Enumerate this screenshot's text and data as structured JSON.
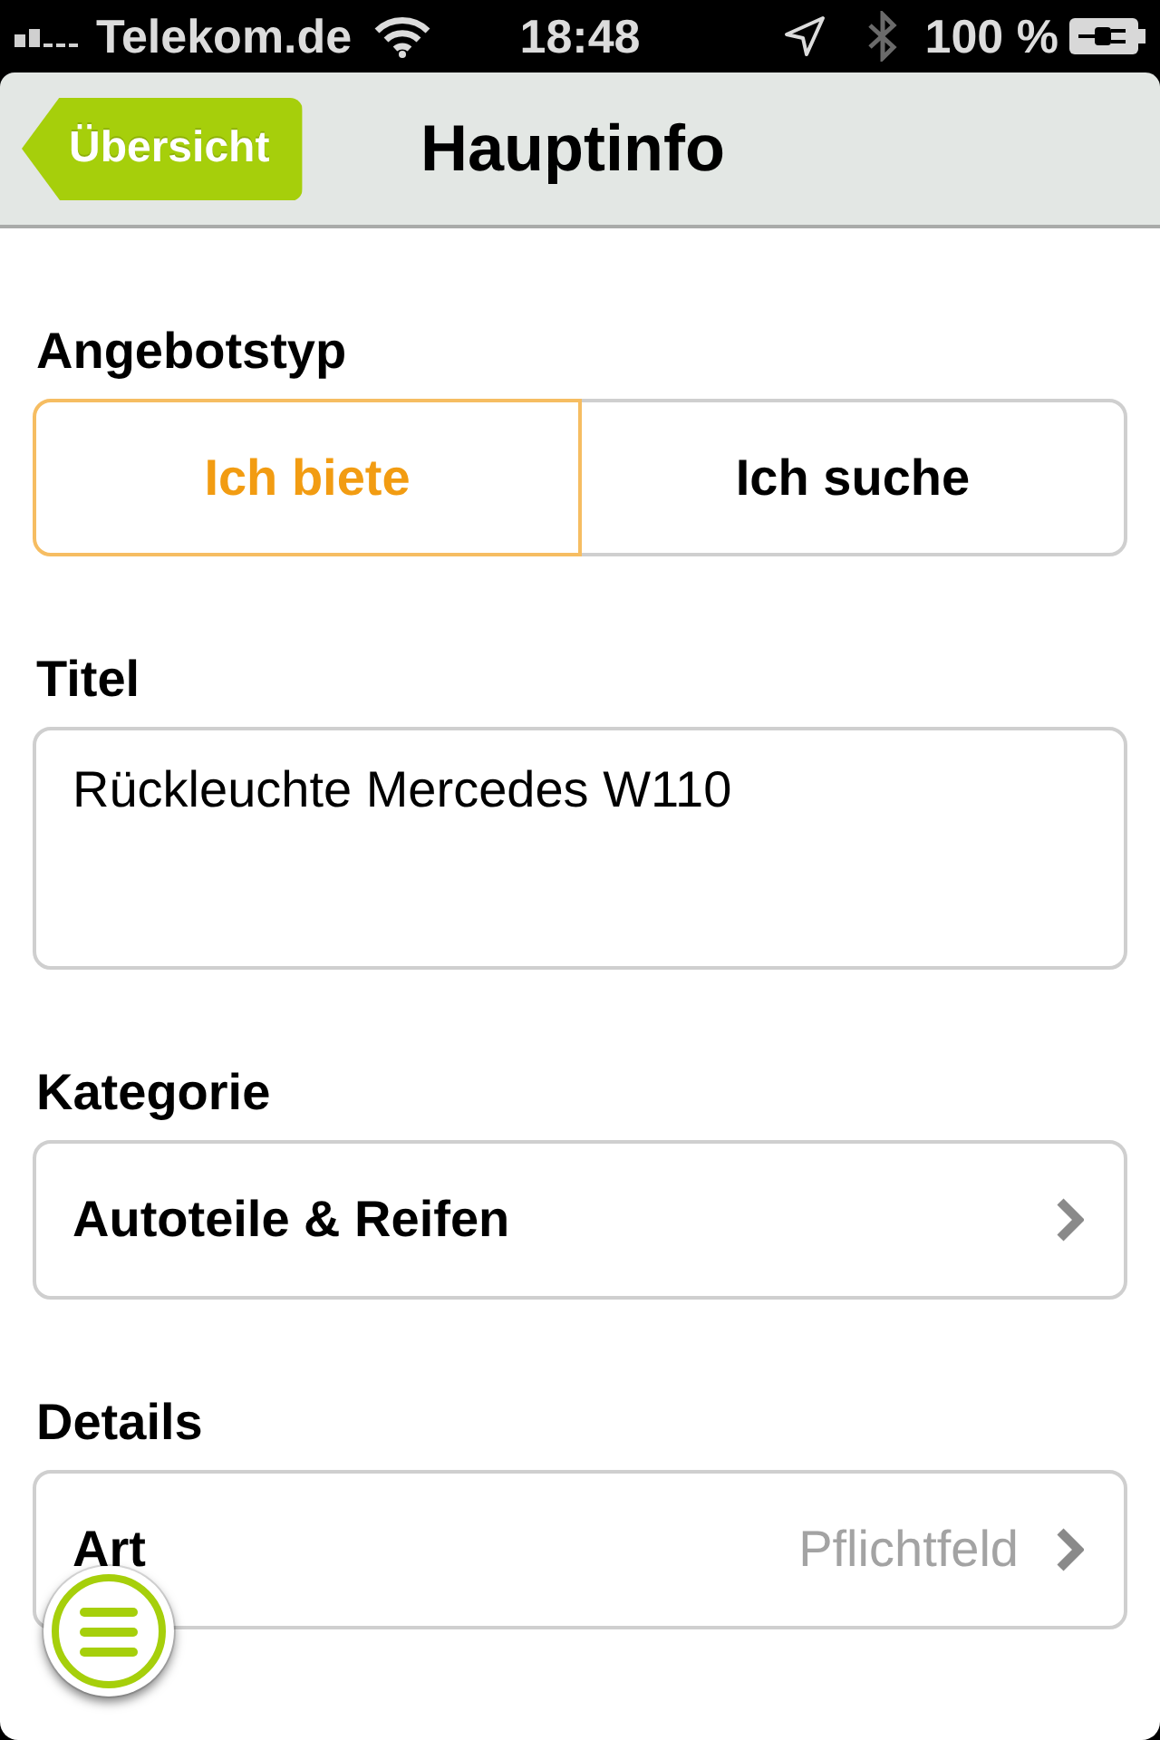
{
  "status_bar": {
    "carrier": "Telekom.de",
    "time": "18:48",
    "battery": "100 %"
  },
  "nav_bar": {
    "back_button": "Übersicht",
    "title": "Hauptinfo"
  },
  "sections": [
    {
      "kind": "segmented",
      "label": "Angebotstyp",
      "options": [
        {
          "label": "Ich biete",
          "selected": true
        },
        {
          "label": "Ich suche",
          "selected": false
        }
      ]
    },
    {
      "kind": "text",
      "label": "Titel",
      "value": "Rückleuchte Mercedes W110"
    },
    {
      "kind": "list",
      "label": "Kategorie",
      "rows": [
        {
          "label": "Autoteile & Reifen"
        }
      ]
    },
    {
      "kind": "list",
      "label": "Details",
      "rows": [
        {
          "label": "Art",
          "placeholder": "Pflichtfeld"
        }
      ]
    }
  ]
}
